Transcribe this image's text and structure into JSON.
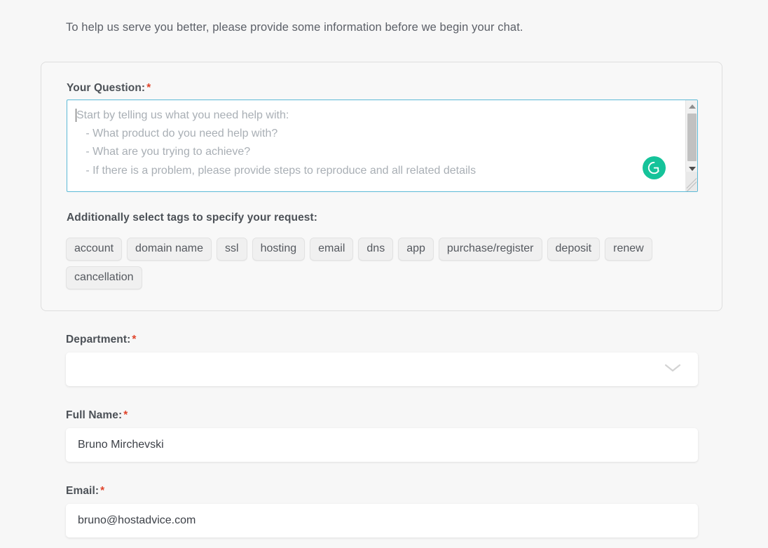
{
  "intro": {
    "text": "To help us serve you better, please provide some information before we begin your chat."
  },
  "question_section": {
    "label": "Your Question:",
    "required_marker": "*",
    "textarea": {
      "value": "",
      "placeholder": "Start by telling us what you need help with:\n   - What product do you need help with?\n   - What are you trying to achieve?\n   - If there is a problem, please provide steps to reproduce and all related details"
    },
    "assistant_badge": {
      "name": "grammarly-icon",
      "color": "#15c39a"
    },
    "tags_label": "Additionally select tags to specify your request:",
    "tags": [
      "account",
      "domain name",
      "ssl",
      "hosting",
      "email",
      "dns",
      "app",
      "purchase/register",
      "deposit",
      "renew",
      "cancellation"
    ]
  },
  "fields": {
    "department": {
      "label": "Department:",
      "required_marker": "*",
      "value": "",
      "icon": "chevron-down-icon"
    },
    "full_name": {
      "label": "Full Name:",
      "required_marker": "*",
      "value": "Bruno Mirchevski"
    },
    "email": {
      "label": "Email:",
      "required_marker": "*",
      "value": "bruno@hostadvice.com"
    }
  },
  "colors": {
    "page_background": "#f7f7f7",
    "required_asterisk": "#e0452c",
    "textarea_border_focus": "#5cb9d6",
    "tag_background": "#f0f0f0",
    "accent_green": "#15c39a"
  }
}
